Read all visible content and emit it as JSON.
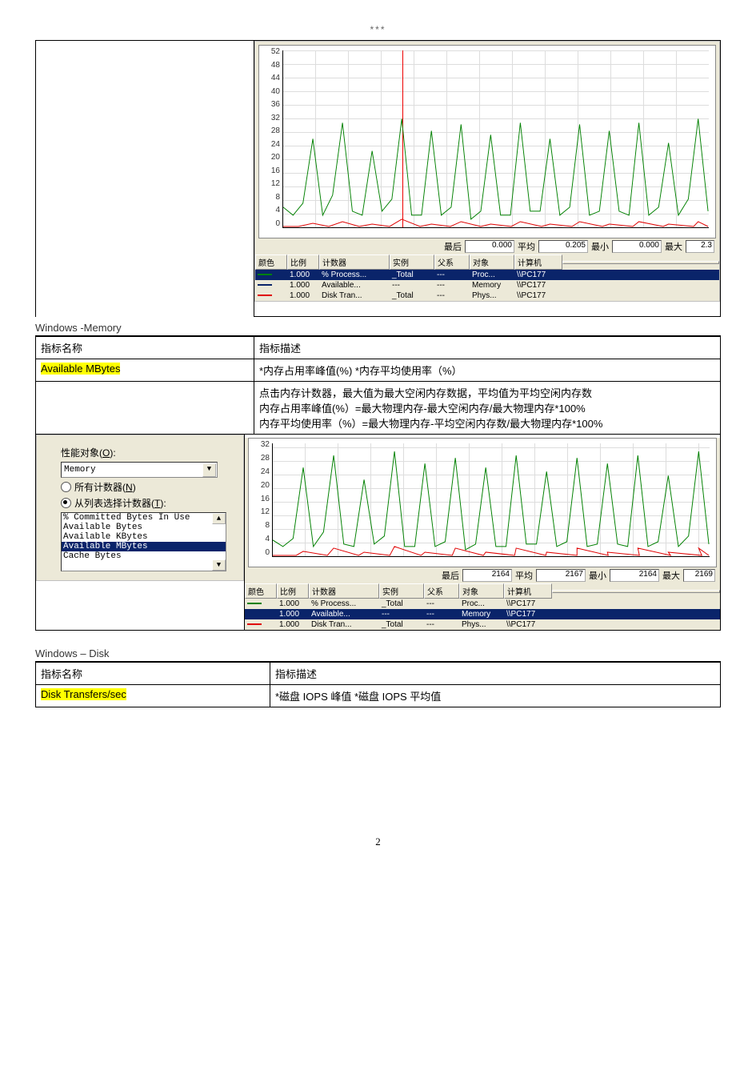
{
  "stars": "***",
  "chart_data": [
    {
      "type": "line",
      "title": "",
      "y_ticks": [
        52,
        48,
        44,
        40,
        36,
        32,
        28,
        24,
        20,
        16,
        12,
        8,
        4,
        0
      ],
      "series": [
        {
          "name": "% Process... _Total",
          "color": "#008000",
          "values": [
            6,
            4,
            8,
            26,
            4,
            9,
            30,
            5,
            4,
            22,
            5,
            8,
            31,
            4,
            4,
            28,
            4,
            6,
            29,
            3,
            5,
            27,
            4,
            4,
            30,
            5,
            5,
            26,
            4,
            6,
            29,
            4,
            5,
            28,
            5,
            4,
            30,
            4,
            6,
            25,
            4,
            8,
            31
          ]
        },
        {
          "name": "Available...",
          "color": "#0a246a",
          "values": []
        },
        {
          "name": "Disk Tran... _Total",
          "color": "#e00000",
          "values": [
            0,
            0,
            0,
            1,
            0,
            0,
            2,
            0,
            0,
            1,
            0,
            0,
            3,
            0,
            0,
            1,
            0,
            0,
            2,
            0,
            0,
            1,
            0,
            0,
            2,
            0,
            0,
            1,
            0,
            0,
            2,
            0,
            0,
            1,
            0,
            0,
            2,
            0,
            0,
            1,
            0,
            0,
            2
          ]
        }
      ],
      "cursor_x_percent": 28,
      "stats": {
        "最后": "0.000",
        "平均": "0.205",
        "最小": "0.000",
        "最大": "2.3"
      }
    },
    {
      "type": "line",
      "title": "",
      "y_ticks": [
        32,
        28,
        24,
        20,
        16,
        12,
        8,
        4,
        0
      ],
      "series": [
        {
          "name": "% Process... _Total",
          "color": "#008000",
          "values": [
            6,
            4,
            8,
            26,
            4,
            9,
            30,
            5,
            4,
            22,
            5,
            8,
            31,
            4,
            4,
            28,
            4,
            6,
            29,
            3,
            5,
            27,
            4,
            4,
            30,
            5,
            5,
            26,
            4,
            6,
            29,
            4,
            5,
            28,
            5,
            4,
            30,
            4,
            6,
            25,
            4,
            8,
            31
          ]
        },
        {
          "name": "Available...",
          "color": "#0a246a",
          "values": []
        },
        {
          "name": "Disk Tran... _Total",
          "color": "#e00000",
          "values": [
            1,
            0,
            0,
            2,
            0,
            0,
            3,
            0,
            0,
            2,
            0,
            0,
            4,
            0,
            0,
            2,
            0,
            0,
            3,
            0,
            0,
            2,
            0,
            0,
            3,
            0,
            0,
            2,
            0,
            0,
            3,
            0,
            0,
            2,
            0,
            0,
            3,
            0,
            0,
            2,
            0,
            0,
            3
          ]
        }
      ],
      "stats": {
        "最后": "2164",
        "平均": "2167",
        "最小": "2164",
        "最大": "2169"
      }
    }
  ],
  "perfmon1": {
    "stat_labels": {
      "last": "最后",
      "avg": "平均",
      "min": "最小",
      "max": "最大"
    },
    "stat_values": {
      "last": "0.000",
      "avg": "0.205",
      "min": "0.000",
      "max": "2.3"
    },
    "legend_headers": [
      "颜色",
      "比例",
      "计数器",
      "实例",
      "父系",
      "对象",
      "计算机",
      ""
    ],
    "legend_rows": [
      {
        "color": "#008000",
        "scale": "1.000",
        "counter": "% Process...",
        "instance": "_Total",
        "parent": "---",
        "object": "Proc...",
        "computer": "\\\\PC177",
        "selected": true
      },
      {
        "color": "#0a246a",
        "scale": "1.000",
        "counter": "Available...",
        "instance": "---",
        "parent": "---",
        "object": "Memory",
        "computer": "\\\\PC177",
        "selected": false
      },
      {
        "color": "#e00000",
        "scale": "1.000",
        "counter": "Disk Tran...",
        "instance": "_Total",
        "parent": "---",
        "object": "Phys...",
        "computer": "\\\\PC177",
        "selected": false
      }
    ]
  },
  "perfmon2": {
    "stat_labels": {
      "last": "最后",
      "avg": "平均",
      "min": "最小",
      "max": "最大"
    },
    "stat_values": {
      "last": "2164",
      "avg": "2167",
      "min": "2164",
      "max": "2169"
    },
    "legend_headers": [
      "颜色",
      "比例",
      "计数器",
      "实例",
      "父系",
      "对象",
      "计算机",
      ""
    ],
    "legend_rows": [
      {
        "color": "#008000",
        "scale": "1.000",
        "counter": "% Process...",
        "instance": "_Total",
        "parent": "---",
        "object": "Proc...",
        "computer": "\\\\PC177",
        "selected": false
      },
      {
        "color": "#0a246a",
        "scale": "1.000",
        "counter": "Available...",
        "instance": "---",
        "parent": "---",
        "object": "Memory",
        "computer": "\\\\PC177",
        "selected": true
      },
      {
        "color": "#e00000",
        "scale": "1.000",
        "counter": "Disk Tran...",
        "instance": "_Total",
        "parent": "---",
        "object": "Phys...",
        "computer": "\\\\PC177",
        "selected": false
      }
    ]
  },
  "memory_section": {
    "title": "Windows  -Memory",
    "col_name": "指标名称",
    "col_desc": "指标描述",
    "metric_name": "Available MBytes",
    "metric_desc_row1": "*内存占用率峰值(%)      *内存平均使用率（%）",
    "metric_desc_row2_l1": "点击内存计数器，最大值为最大空闲内存数据，平均值为平均空闲内存数",
    "metric_desc_row2_l2": "内存占用率峰值(%）=最大物理内存-最大空闲内存/最大物理内存*100%",
    "metric_desc_row2_l3": "内存平均使用率（%）=最大物理内存-平均空闲内存数/最大物理内存*100%"
  },
  "selector": {
    "label_object": "性能对象",
    "label_object_accel": "O",
    "combo_value": "Memory",
    "radio_all": "所有计数器",
    "radio_all_accel": "N",
    "radio_list": "从列表选择计数器",
    "radio_list_accel": "T",
    "list_items": [
      "% Committed Bytes In Use",
      "Available Bytes",
      "Available KBytes",
      "Available MBytes",
      "Cache Bytes"
    ],
    "list_selected_index": 3
  },
  "disk_section": {
    "title": "Windows – Disk",
    "col_name": "指标名称",
    "col_desc": "指标描述",
    "metric_name": "Disk Transfers/sec",
    "metric_desc": "*磁盘 IOPS 峰值      *磁盘 IOPS 平均值"
  },
  "page_number": "2"
}
